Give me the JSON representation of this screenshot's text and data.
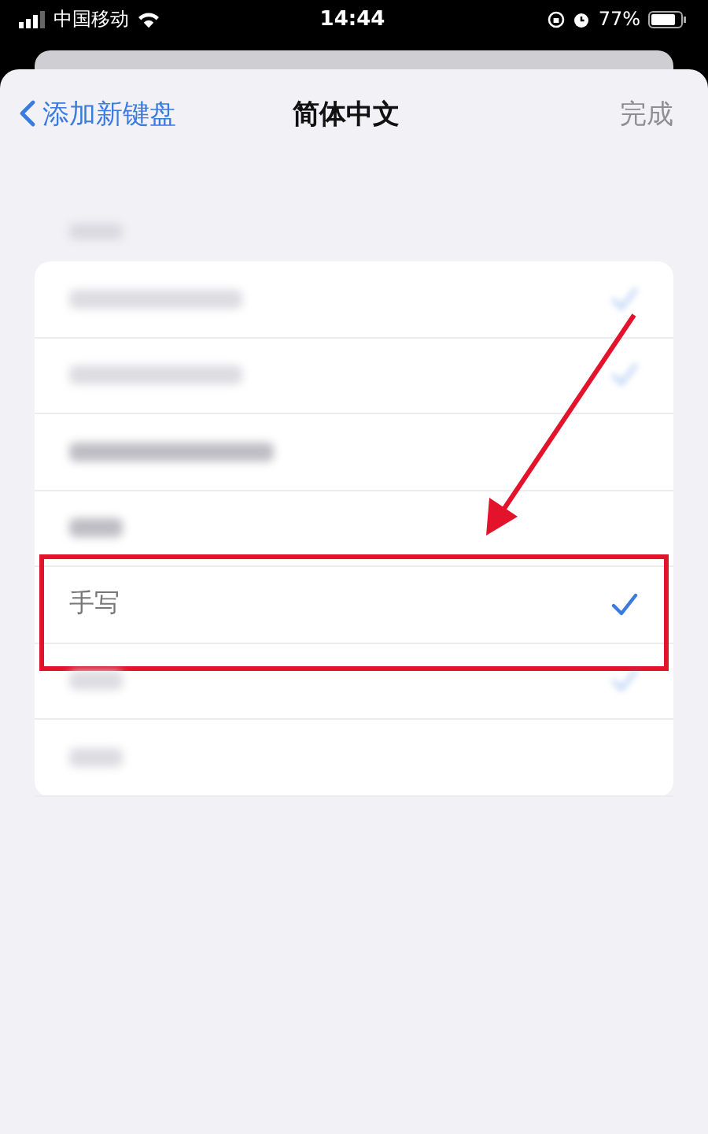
{
  "status_bar": {
    "carrier": "中国移动",
    "time": "14:44",
    "battery": "77%"
  },
  "nav": {
    "back": "添加新键盘",
    "title": "简体中文",
    "done": "完成",
    "done_disabled": true
  },
  "section": {
    "header_blurred": true
  },
  "rows": [
    {
      "kind": "blurred",
      "checked": true,
      "highlighted": false
    },
    {
      "kind": "blurred",
      "checked": true,
      "highlighted": false
    },
    {
      "kind": "blurred",
      "checked": false,
      "highlighted": false
    },
    {
      "kind": "blurred",
      "checked": false,
      "highlighted": false
    },
    {
      "kind": "text",
      "label": "手写",
      "checked": true,
      "highlighted": true
    },
    {
      "kind": "blurred",
      "checked": true,
      "highlighted": false
    },
    {
      "kind": "blurred",
      "checked": false,
      "highlighted": false
    }
  ],
  "annotation": {
    "arrow": true
  }
}
